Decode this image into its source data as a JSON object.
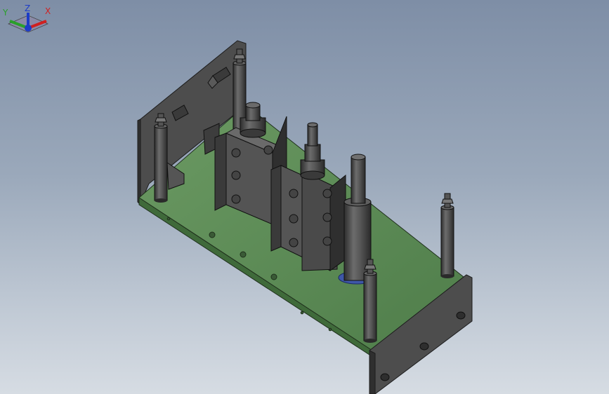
{
  "scene": {
    "background_top": "#7e8ea6",
    "background_bottom": "#d6dce3",
    "plate_color": "#5b8a55",
    "part_color": "#4e4e4e"
  },
  "triad": {
    "x_label": "X",
    "y_label": "Y",
    "z_label": "Z",
    "x_color": "#d02020",
    "y_color": "#2aa02a",
    "z_color": "#1c3cc8"
  }
}
